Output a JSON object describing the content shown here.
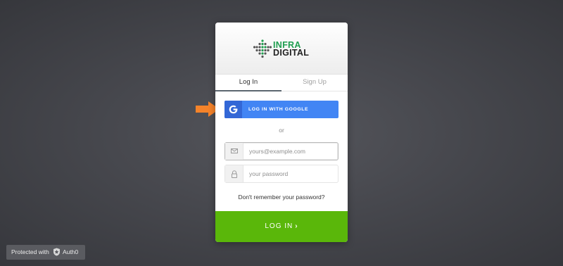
{
  "brand": {
    "line1": "INFRA",
    "line2": "DIGITAL",
    "primary_color": "#1e9e4f"
  },
  "tabs": [
    {
      "label": "Log In",
      "active": true
    },
    {
      "label": "Sign Up",
      "active": false
    }
  ],
  "google_button": {
    "label": "LOG IN WITH GOOGLE",
    "icon": "google-g-icon",
    "color": "#4285f4"
  },
  "divider_text": "or",
  "email_field": {
    "placeholder": "yours@example.com",
    "value": "",
    "icon": "envelope-icon"
  },
  "password_field": {
    "placeholder": "your password",
    "value": "",
    "icon": "lock-icon"
  },
  "forgot_password": "Don't remember your password?",
  "submit_button": {
    "label": "LOG IN",
    "chevron": "›",
    "color": "#5ab70a"
  },
  "annotation": {
    "icon": "arrow-right-icon",
    "color": "#f5832a"
  },
  "footer_badge": {
    "text": "Protected with",
    "brand": "Auth0",
    "icon": "auth0-shield-icon"
  }
}
